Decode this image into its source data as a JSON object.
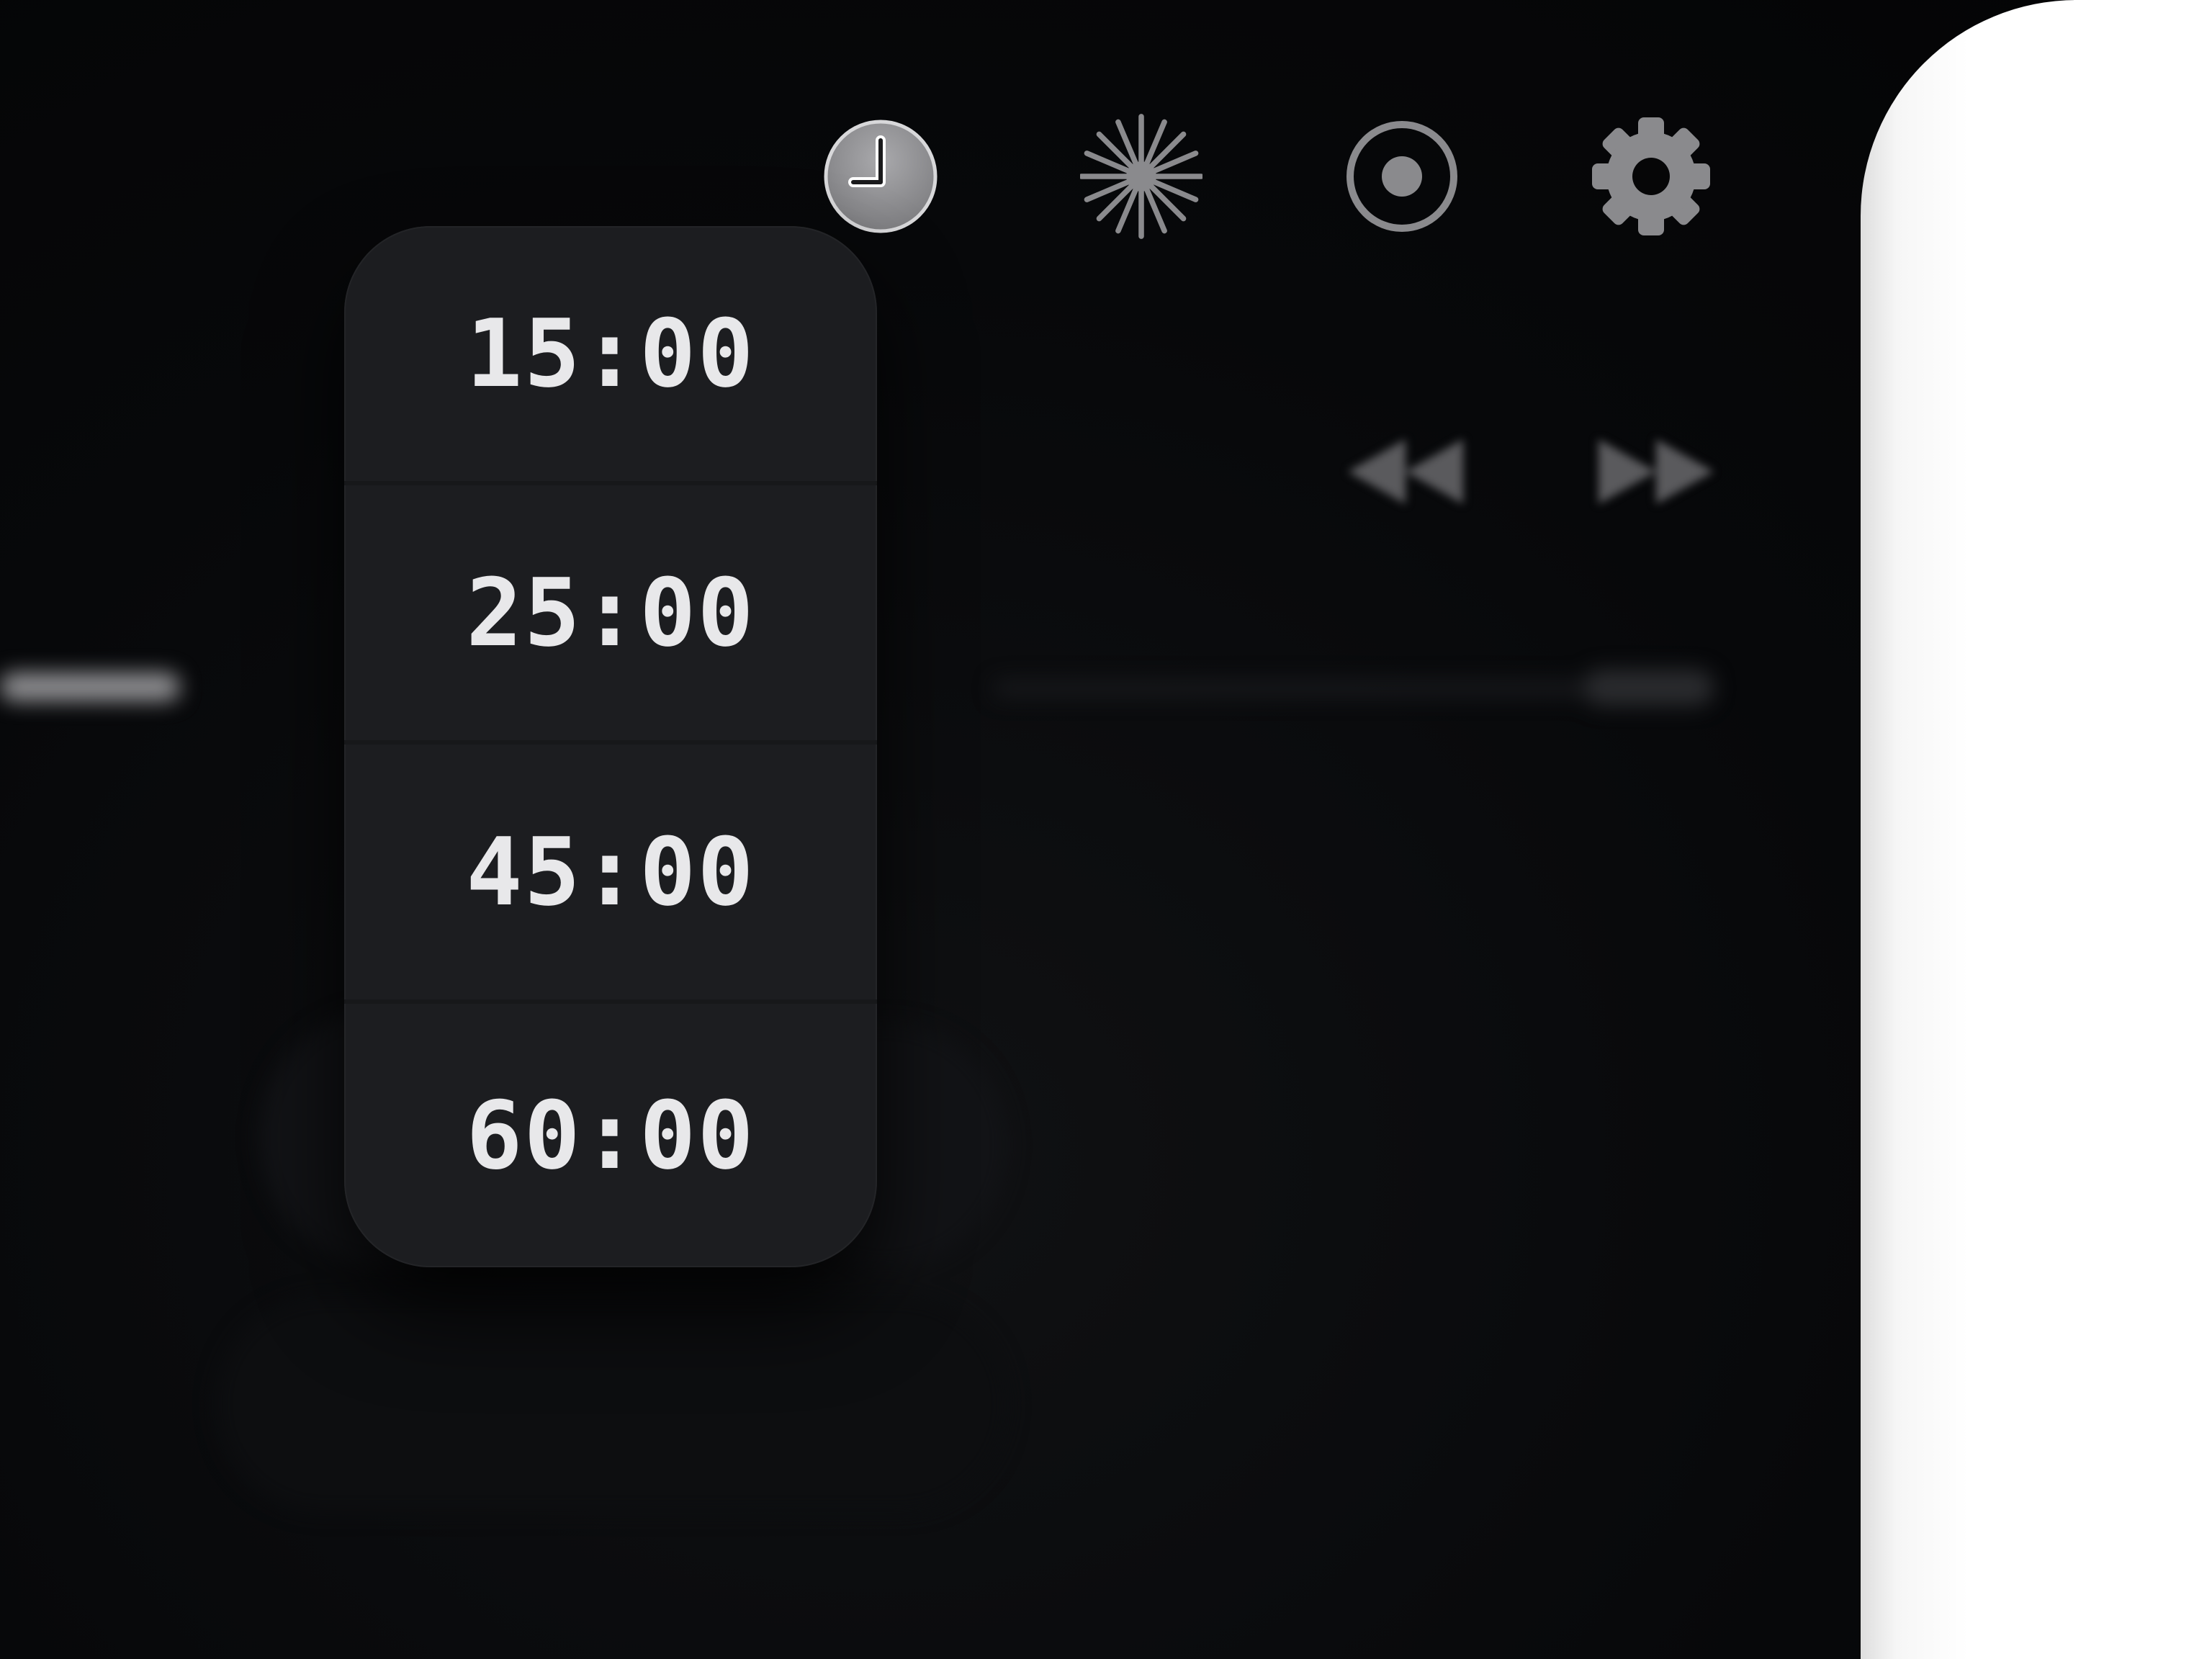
{
  "toolbar": {
    "buttons": [
      {
        "name": "timer-button",
        "icon": "clock-icon",
        "active": true
      },
      {
        "name": "ambient-sound-button",
        "icon": "starburst-icon",
        "active": false
      },
      {
        "name": "focus-button",
        "icon": "target-icon",
        "active": false
      },
      {
        "name": "settings-button",
        "icon": "gear-icon",
        "active": false
      }
    ]
  },
  "timer_menu": {
    "options": [
      "15:00",
      "25:00",
      "45:00",
      "60:00"
    ]
  },
  "colors": {
    "background": "#050506",
    "menu_bg": "#1c1d20",
    "menu_text": "#e8e8ea",
    "icon": "#8a8a8d",
    "active_icon_fill": "#9a9a9d",
    "panel": "#ffffff"
  }
}
